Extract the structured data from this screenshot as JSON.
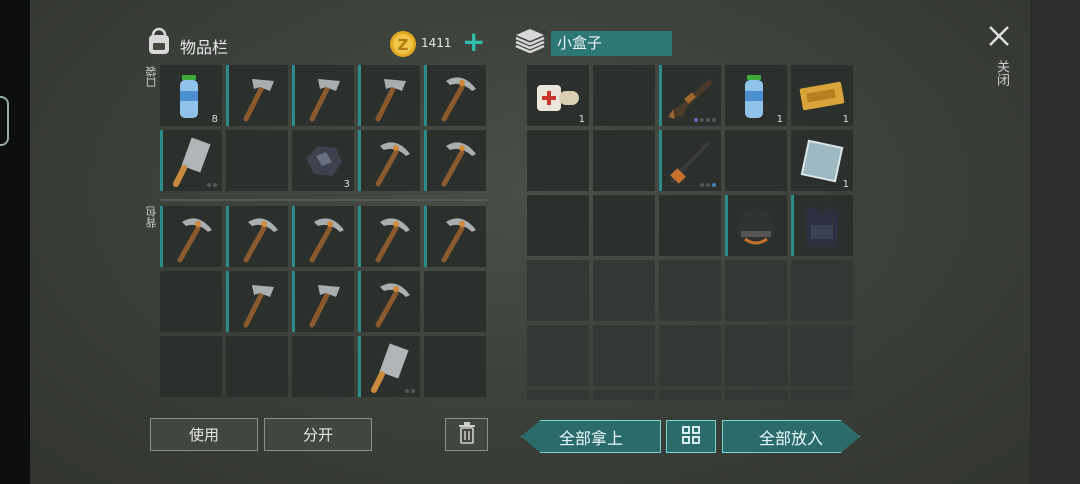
{
  "inventory": {
    "title": "物品栏",
    "pocket_label": "口袋",
    "backpack_label": "背包"
  },
  "currency": {
    "amount": "1411",
    "add_symbol": "+"
  },
  "container": {
    "title": "小盒子"
  },
  "close": {
    "label": "关闭"
  },
  "actions": {
    "use_label": "使用",
    "split_label": "分开",
    "take_all_label": "全部拿上",
    "put_all_label": "全部放入"
  },
  "pocket_slots": [
    {
      "item": "water-bottle",
      "count": "8"
    },
    {
      "item": "hammer"
    },
    {
      "item": "hammer"
    },
    {
      "item": "hammer"
    },
    {
      "item": "pickaxe"
    },
    {
      "item": "cleaver"
    },
    {
      "item": ""
    },
    {
      "item": "ore",
      "count": "3"
    },
    {
      "item": "pickaxe"
    },
    {
      "item": "pickaxe"
    }
  ],
  "backpack_slots": [
    {
      "item": "pickaxe"
    },
    {
      "item": "pickaxe"
    },
    {
      "item": "pickaxe"
    },
    {
      "item": "pickaxe"
    },
    {
      "item": "pickaxe"
    },
    {
      "item": ""
    },
    {
      "item": "hammer"
    },
    {
      "item": "hammer"
    },
    {
      "item": "pickaxe"
    },
    {
      "item": ""
    },
    {
      "item": ""
    },
    {
      "item": ""
    },
    {
      "item": ""
    },
    {
      "item": "cleaver"
    },
    {
      "item": ""
    }
  ],
  "container_slots": [
    {
      "item": "bandage",
      "count": "1"
    },
    {
      "item": ""
    },
    {
      "item": "assault-rifle"
    },
    {
      "item": "water-bottle",
      "count": "1"
    },
    {
      "item": "coupon",
      "count": "1"
    },
    {
      "item": ""
    },
    {
      "item": ""
    },
    {
      "item": "sniper-rifle"
    },
    {
      "item": ""
    },
    {
      "item": "glass-pane",
      "count": "1"
    },
    {
      "item": ""
    },
    {
      "item": ""
    },
    {
      "item": ""
    },
    {
      "item": "helmet"
    },
    {
      "item": "body-armor"
    },
    {
      "item": ""
    },
    {
      "item": ""
    },
    {
      "item": ""
    },
    {
      "item": ""
    },
    {
      "item": ""
    },
    {
      "item": ""
    },
    {
      "item": ""
    },
    {
      "item": ""
    },
    {
      "item": ""
    },
    {
      "item": ""
    },
    {
      "item": ""
    },
    {
      "item": ""
    },
    {
      "item": ""
    },
    {
      "item": ""
    },
    {
      "item": ""
    }
  ]
}
